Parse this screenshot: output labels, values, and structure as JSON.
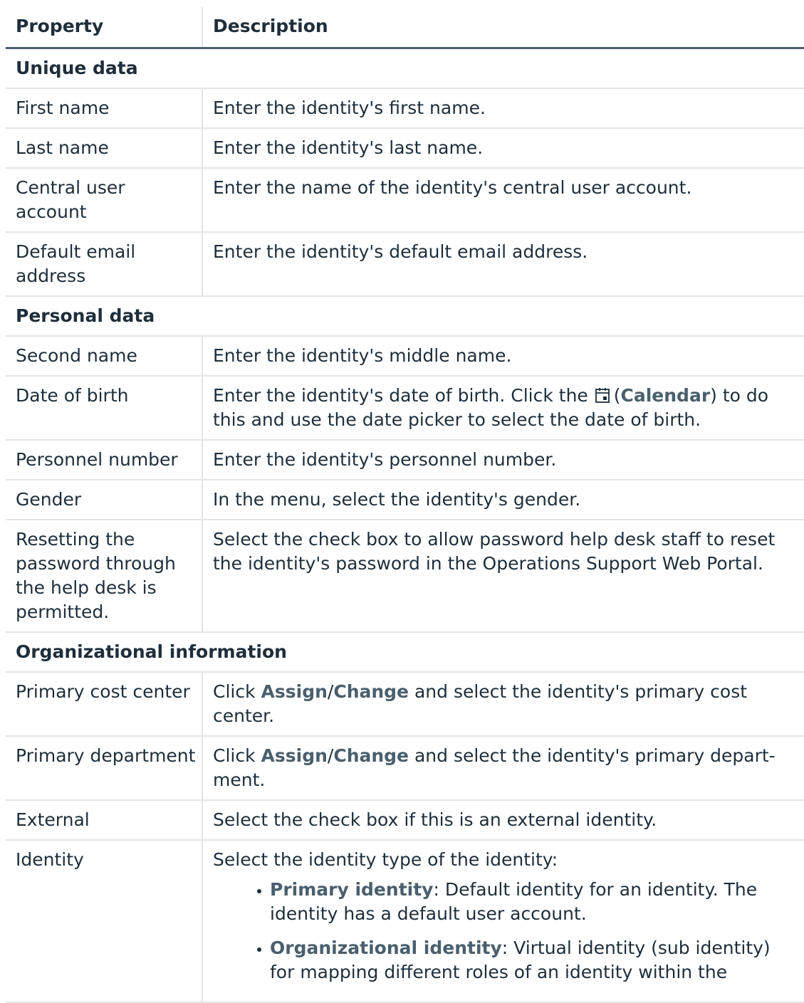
{
  "table": {
    "headers": {
      "property": "Property",
      "description": "Description"
    },
    "sections": {
      "unique": "Unique data",
      "personal": "Personal data",
      "org": "Organizational information"
    },
    "rows": {
      "first_name": {
        "property": "First name",
        "description": "Enter the identity's first name."
      },
      "last_name": {
        "property": "Last name",
        "description": "Enter the identity's last name."
      },
      "central_user": {
        "property": "Central user account",
        "description": "Enter the name of the identity's central user account."
      },
      "default_email": {
        "property": "Default email address",
        "description": "Enter the identity's default email address."
      },
      "second_name": {
        "property": "Second name",
        "description": "Enter the identity's middle name."
      },
      "date_of_birth": {
        "property": "Date of birth",
        "desc_before": "Enter the identity's date of birth. Click the",
        "icon": "calendar-icon",
        "paren_open": "(",
        "icon_label": "Calendar",
        "desc_after": ") to do this and use the date picker to select the date of birth."
      },
      "personnel_number": {
        "property": "Personnel number",
        "description": "Enter the identity's personnel number."
      },
      "gender": {
        "property": "Gender",
        "description": "In the menu, select the identity's gender."
      },
      "reset_password": {
        "property": "Resetting the password through the help desk is permitted.",
        "description": "Select the check box to allow password help desk staff to reset the identity's password in the Operations Support Web Portal."
      },
      "primary_cost_center": {
        "property": "Primary cost center",
        "click": "Click",
        "assign": "Assign",
        "slash": "/",
        "change": "Change",
        "desc_after": "and select the identity's primary cost center."
      },
      "primary_department": {
        "property": "Primary department",
        "click": "Click",
        "assign": "Assign",
        "slash": "/",
        "change": "Change",
        "desc_after_1": "and select the identity's primary depart-",
        "desc_after_2": "ment."
      },
      "external": {
        "property": "External",
        "description": "Select the check box if this is an external identity."
      },
      "identity": {
        "property": "Identity",
        "intro": "Select the identity type of the identity:",
        "items": [
          {
            "term": "Primary identity",
            "text": ": Default identity for an identity. The identity has a default user account."
          },
          {
            "term": "Organizational identity",
            "text": ": Virtual identity (sub identity) for mapping different roles of an identity within the"
          }
        ]
      }
    }
  },
  "colors": {
    "text": "#1e2e3b",
    "emphasis": "#4a5f6d",
    "rule": "#e1e5e8"
  }
}
